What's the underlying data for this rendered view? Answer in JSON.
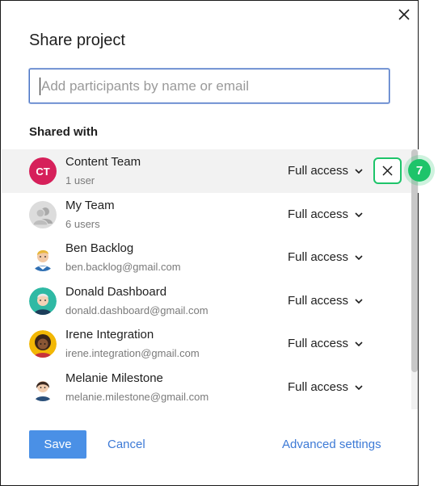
{
  "dialog": {
    "title": "Share project",
    "search": {
      "placeholder": "Add participants by name or email",
      "value": ""
    },
    "section_label": "Shared with",
    "participants": [
      {
        "name": "Content Team",
        "detail": "1 user",
        "access": "Full access",
        "avatar": "initials",
        "initials": "CT"
      },
      {
        "name": "My Team",
        "detail": "6 users",
        "access": "Full access",
        "avatar": "team-icon"
      },
      {
        "name": "Ben Backlog",
        "detail": "ben.backlog@gmail.com",
        "access": "Full access",
        "avatar": "person-illustration"
      },
      {
        "name": "Donald Dashboard",
        "detail": "donald.dashboard@gmail.com",
        "access": "Full access",
        "avatar": "person-illustration"
      },
      {
        "name": "Irene Integration",
        "detail": "irene.integration@gmail.com",
        "access": "Full access",
        "avatar": "person-illustration"
      },
      {
        "name": "Melanie Milestone",
        "detail": "melanie.milestone@gmail.com",
        "access": "Full access",
        "avatar": "person-illustration"
      }
    ],
    "step_badge": "7",
    "footer": {
      "save_label": "Save",
      "cancel_label": "Cancel",
      "advanced_label": "Advanced settings"
    }
  },
  "colors": {
    "accent": "#4a90e6",
    "link": "#3d7ad6",
    "highlight": "#1ec46a",
    "initials_avatar": "#d6205a"
  }
}
